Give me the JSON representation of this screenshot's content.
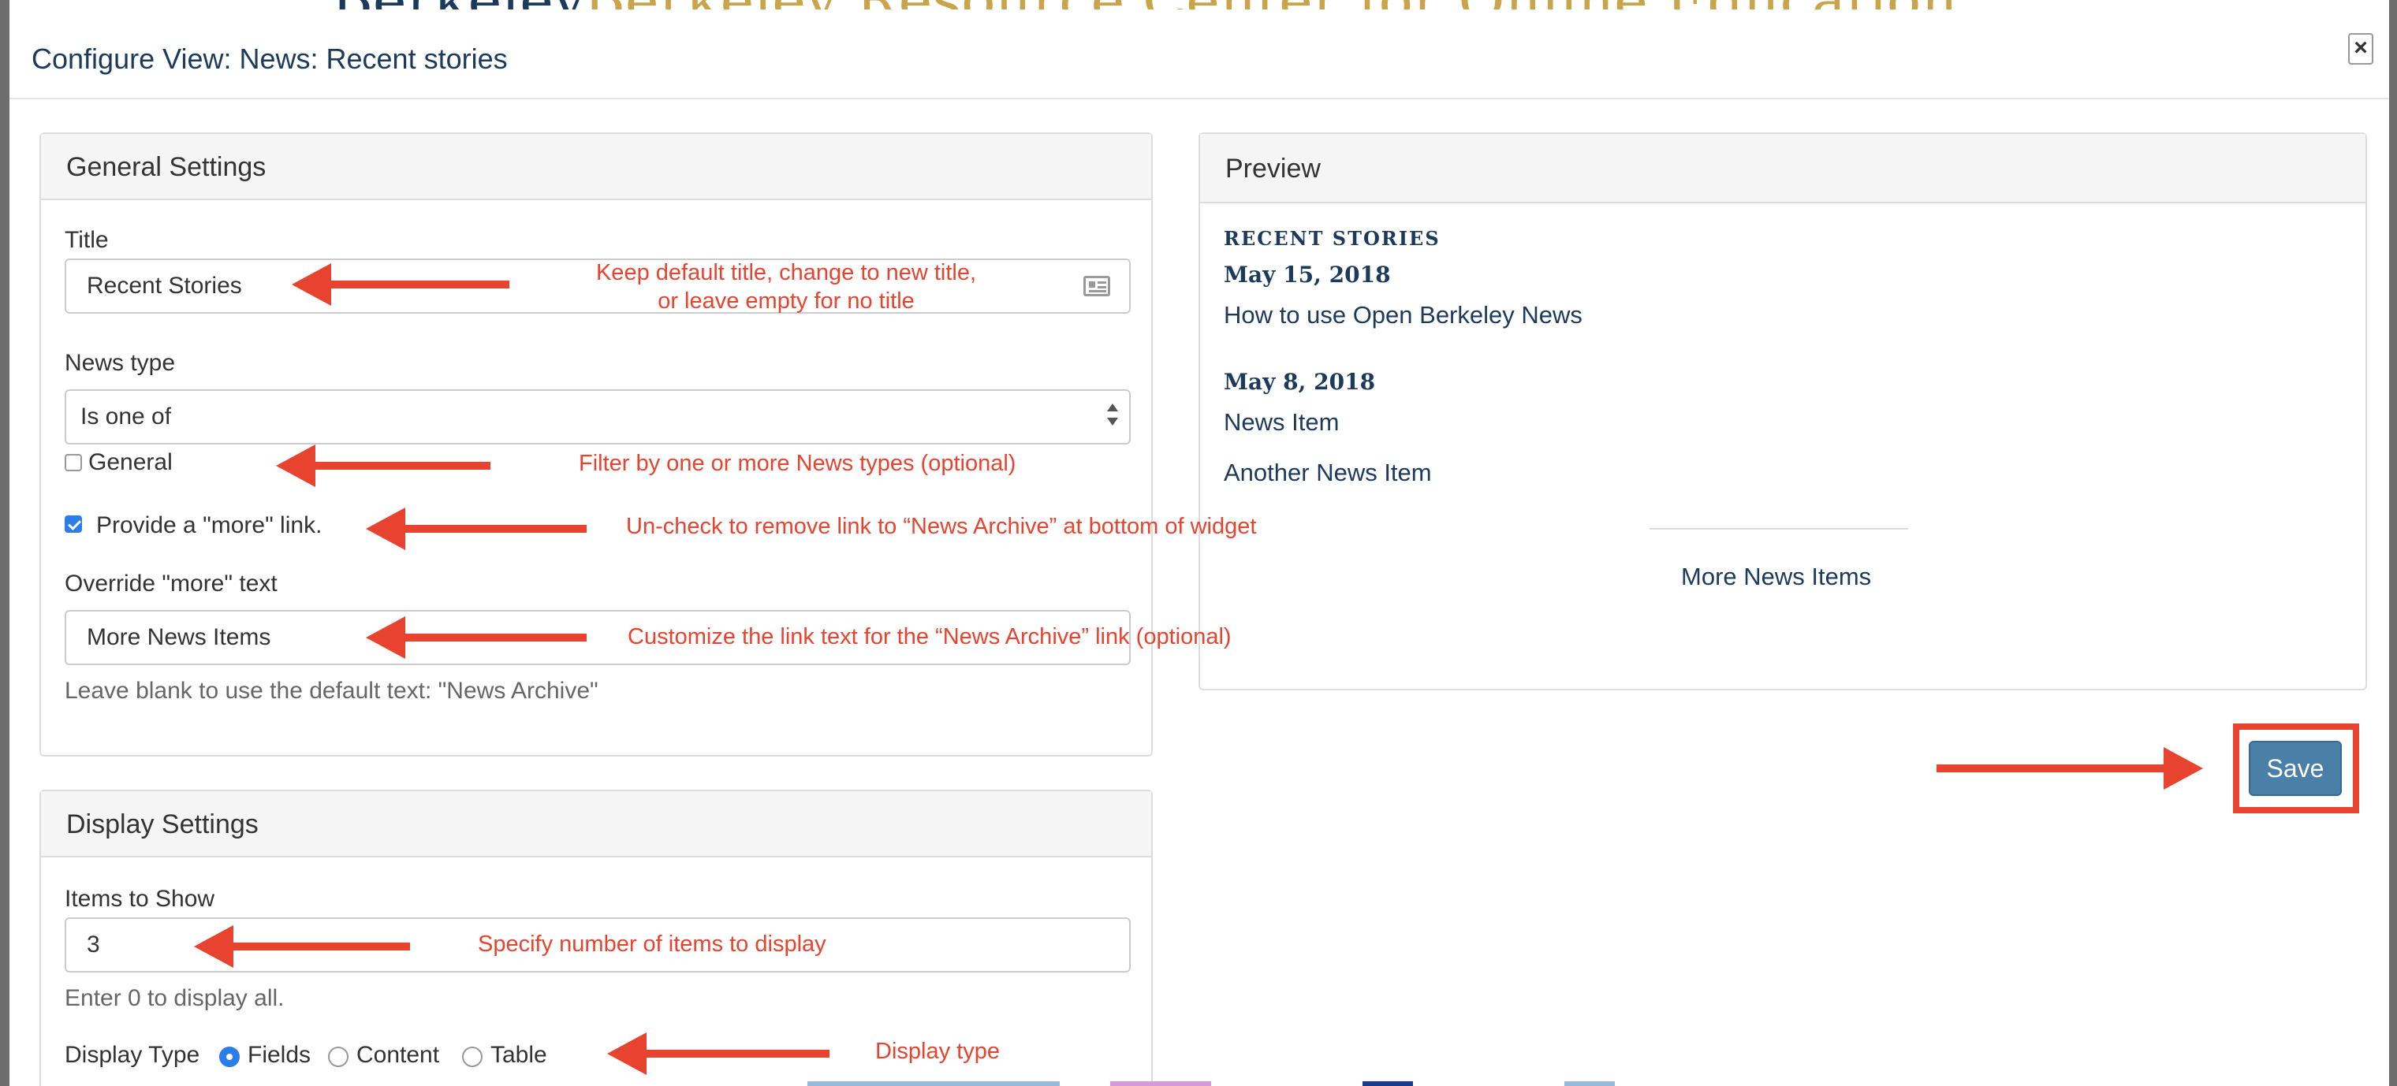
{
  "backdrop": {
    "brand": "Berkeley",
    "site_title": "Berkeley Resource Center for Online Education"
  },
  "modal": {
    "title": "Configure View: News: Recent stories",
    "close_glyph": "×"
  },
  "general_settings": {
    "heading": "General Settings",
    "title_label": "Title",
    "title_value": "Recent Stories",
    "news_type_label": "News type",
    "news_type_selected": "Is one of",
    "general_checkbox_label": "General",
    "more_link_label": "Provide a \"more\" link.",
    "more_link_checked": true,
    "override_label": "Override \"more\" text",
    "override_value": "More News Items",
    "override_help": "Leave blank to use the default text: \"News Archive\""
  },
  "display_settings": {
    "heading": "Display Settings",
    "items_label": "Items to Show",
    "items_value": "3",
    "items_help": "Enter 0 to display all.",
    "display_type_label": "Display Type",
    "options": [
      "Fields",
      "Content",
      "Table"
    ],
    "selected": "Fields"
  },
  "preview": {
    "heading": "Preview",
    "section_title": "RECENT STORIES",
    "entries": [
      {
        "date": "May 15, 2018",
        "items": [
          "How to use Open Berkeley News"
        ]
      },
      {
        "date": "May 8, 2018",
        "items": [
          "News Item",
          "Another News Item"
        ]
      }
    ],
    "more_link": "More News Items"
  },
  "annotations": {
    "title_line1": "Keep default title, change to new title,",
    "title_line2": "or leave empty for no title",
    "news_type": "Filter by one or more News types (optional)",
    "more_link": "Un-check to remove link to “News Archive” at bottom of widget",
    "override": "Customize the link text for the “News Archive” link (optional)",
    "items": "Specify number of items to display",
    "display_type": "Display type"
  },
  "save_label": "Save",
  "colors": {
    "annotation": "#e8432e",
    "brand_navy": "#1b3a5c",
    "save_button": "#4a7fa7",
    "checkbox_blue": "#2b7de9"
  }
}
